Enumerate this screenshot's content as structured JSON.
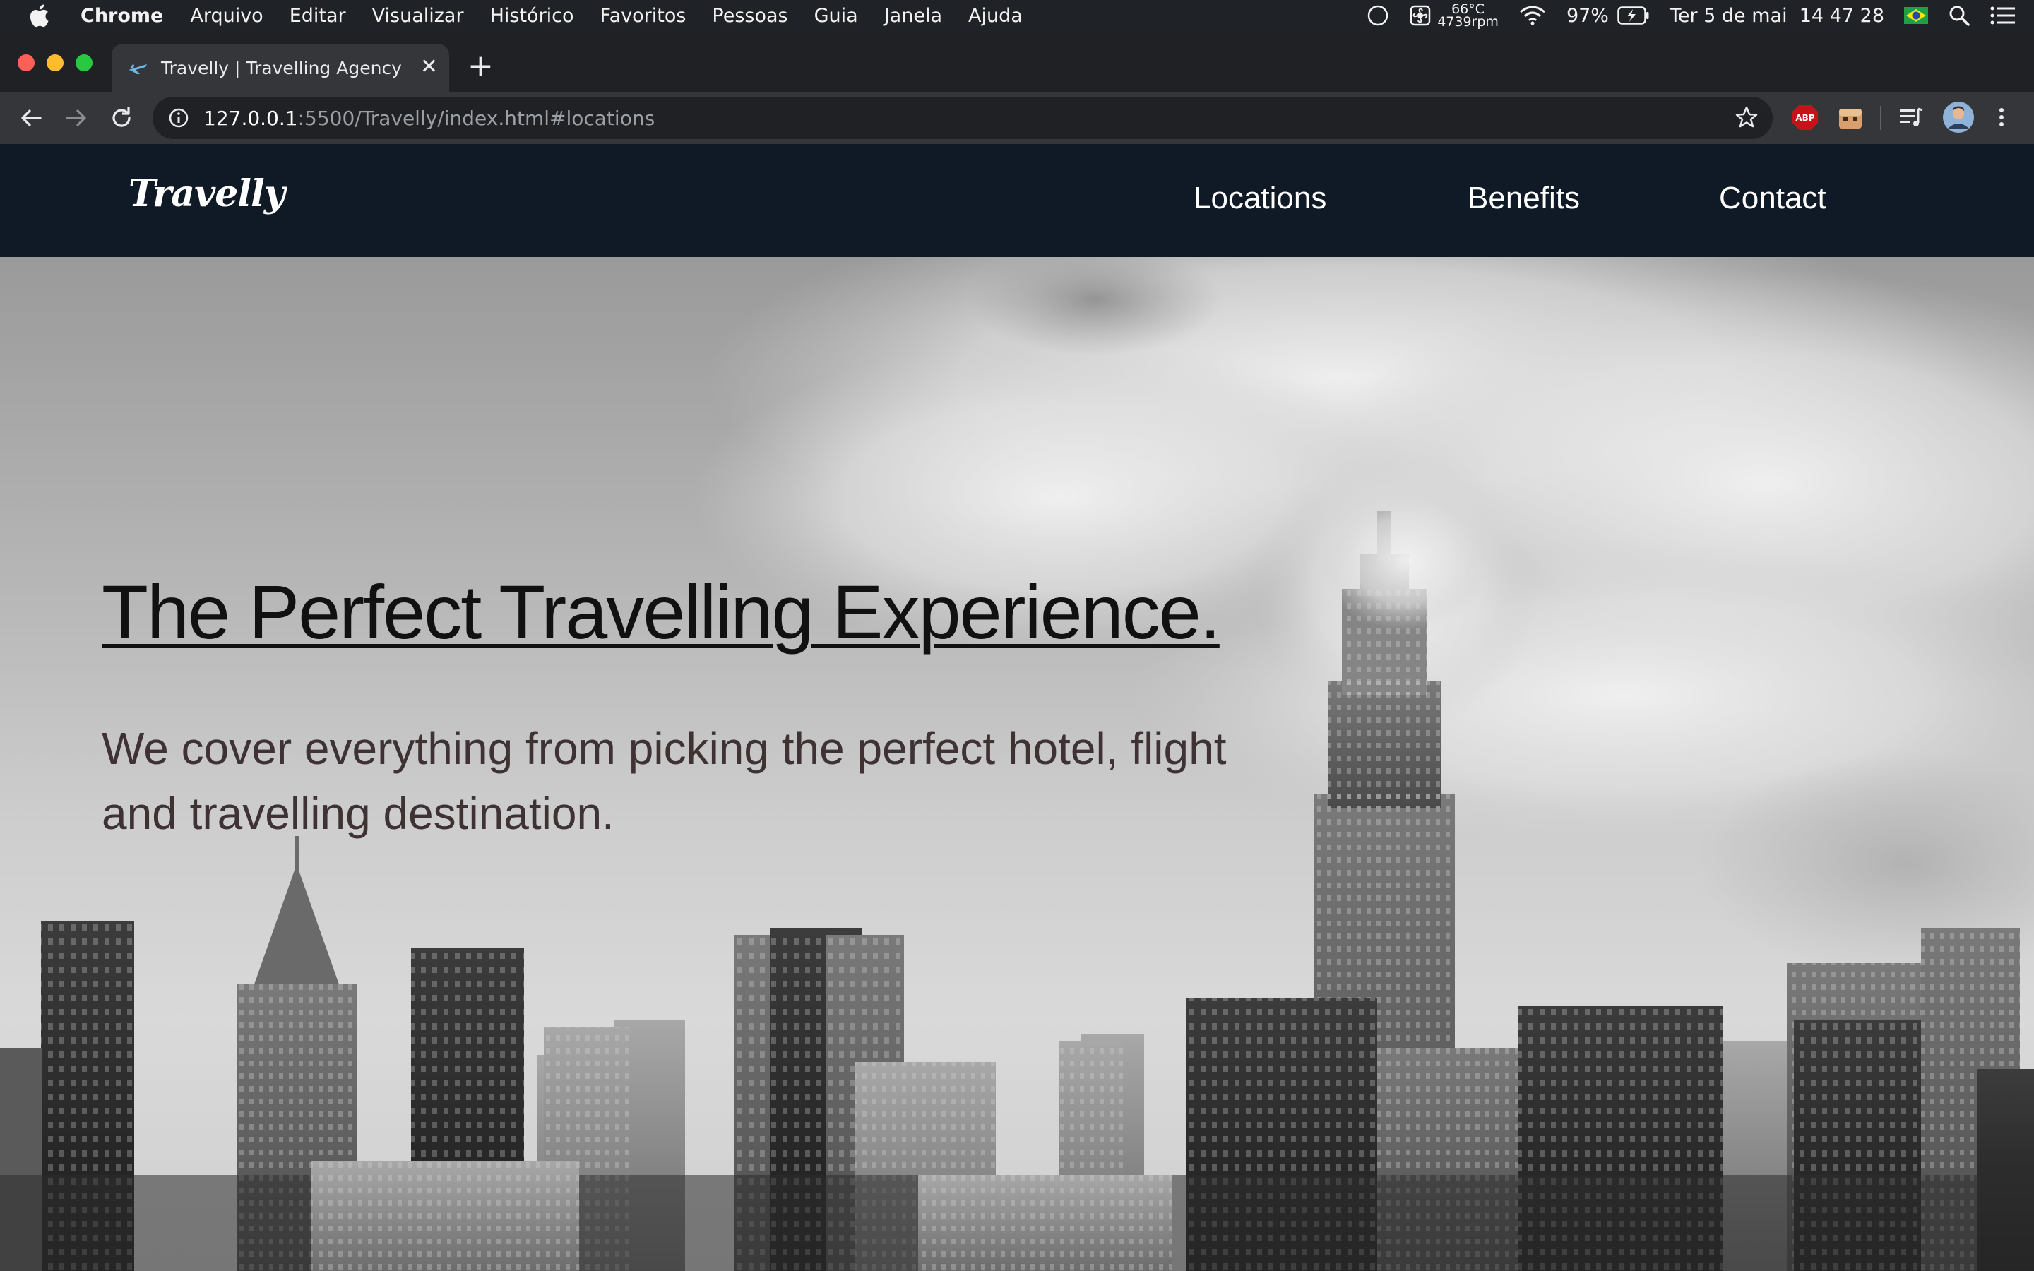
{
  "menubar": {
    "app_name": "Chrome",
    "items": [
      "Arquivo",
      "Editar",
      "Visualizar",
      "Histórico",
      "Favoritos",
      "Pessoas",
      "Guia",
      "Janela",
      "Ajuda"
    ],
    "status": {
      "temperature": "66°C",
      "fan_speed": "4739rpm",
      "battery": "97%",
      "datetime": "Ter 5 de mai  14 47 28"
    }
  },
  "browser": {
    "tab_title": "Travelly | Travelling Agency",
    "url_host": "127.0.0.1",
    "url_rest": ":5500/Travelly/index.html#locations",
    "abp_label": "ABP"
  },
  "site": {
    "logo": "Travelly",
    "nav": {
      "locations": "Locations",
      "benefits": "Benefits",
      "contact": "Contact"
    },
    "hero": {
      "title": "The Perfect Travelling Experience.",
      "subtitle": "We cover everything from picking the perfect hotel, flight and travelling destination."
    }
  },
  "colors": {
    "nav_bg": "#101a26",
    "browser_frame": "#202124",
    "toolbar": "#35363a",
    "subtitle_text": "#3e3234"
  }
}
